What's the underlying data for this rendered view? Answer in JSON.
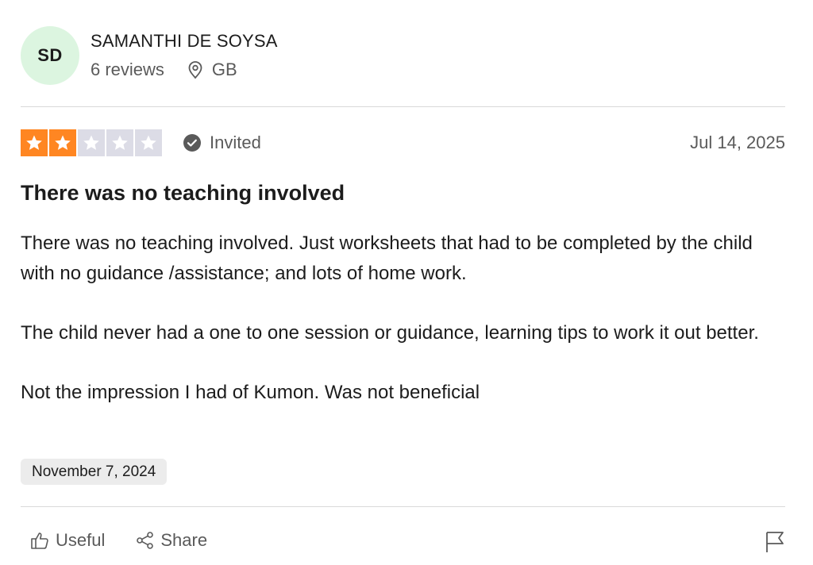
{
  "reviewer": {
    "initials": "SD",
    "name": "SAMANTHI DE SOYSA",
    "reviews_count": "6 reviews",
    "location": "GB"
  },
  "review": {
    "rating": 2,
    "max_rating": 5,
    "star_color_on": "#ff8622",
    "star_color_off": "#dcdce6",
    "invited_label": "Invited",
    "posted_date": "Jul 14, 2025",
    "title": "There was no teaching involved",
    "paragraphs": [
      "There was no teaching involved. Just worksheets that had to be completed by the child with no guidance /assistance; and lots of home work.",
      "The child never had a one to one session or guidance, learning tips to work it out better.",
      "Not the impression I had of Kumon. Was not beneficial"
    ],
    "experience_date": "November 7, 2024"
  },
  "actions": {
    "useful_label": "Useful",
    "share_label": "Share"
  },
  "icons": {
    "location": "location-pin-icon",
    "invited": "check-circle-icon",
    "useful": "thumbs-up-icon",
    "share": "share-icon",
    "report": "flag-icon"
  }
}
